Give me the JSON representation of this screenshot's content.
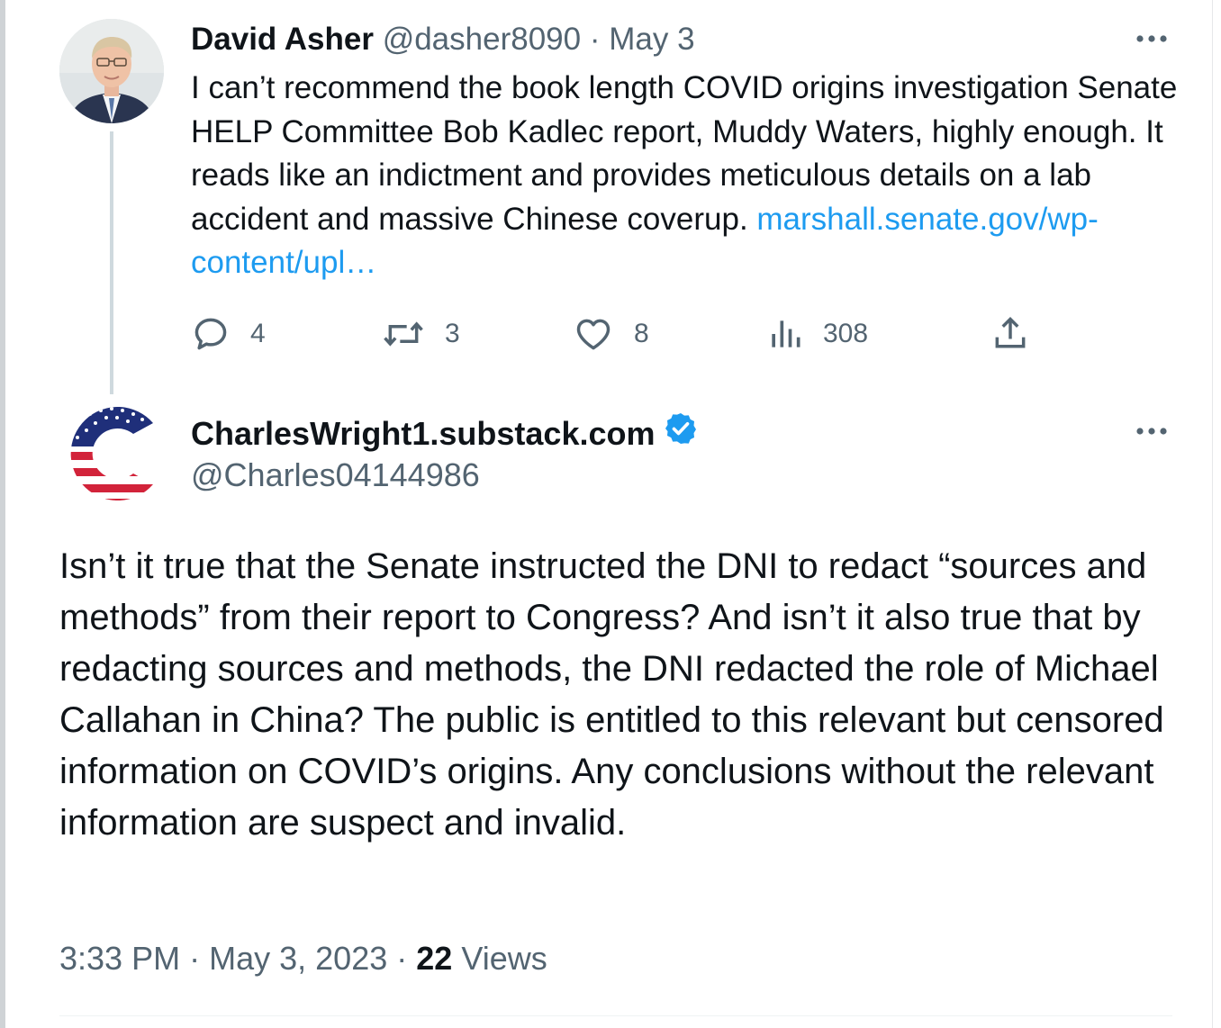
{
  "parent_tweet": {
    "author_name": "David Asher",
    "handle": "@dasher8090",
    "separator": "·",
    "date": "May 3",
    "text": "I can’t recommend the book length COVID origins investigation Senate HELP Committee Bob Kadlec report, Muddy Waters, highly enough. It reads like an indictment and provides meticulous details on a lab accident and massive Chinese coverup. ",
    "link_text": "marshall.senate.gov/wp-content/upl…",
    "actions": {
      "replies": "4",
      "retweets": "3",
      "likes": "8",
      "views": "308"
    }
  },
  "main_tweet": {
    "author_name": "CharlesWright1.substack.com",
    "handle": "@Charles04144986",
    "text": "Isn’t it true that the Senate instructed the DNI to redact “sources and methods” from their report to Congress?   And isn’t it also true that by redacting sources and methods, the DNI redacted the role of Michael Callahan in China?   The public is entitled to this relevant but censored information on COVID’s origins.   Any conclusions without the relevant information are suspect and invalid.",
    "time": "3:33 PM",
    "date": "May 3, 2023",
    "separator": "·",
    "views_count": "22",
    "views_label": "Views"
  },
  "icons": [
    "more-icon",
    "reply-icon",
    "retweet-icon",
    "like-icon",
    "views-icon",
    "share-icon",
    "verified-badge-icon"
  ],
  "colors": {
    "link": "#1d9bf0",
    "secondary_text": "#536471",
    "primary_text": "#0f1419",
    "verified": "#1d9bf0",
    "thread_line": "#cfd9de"
  }
}
